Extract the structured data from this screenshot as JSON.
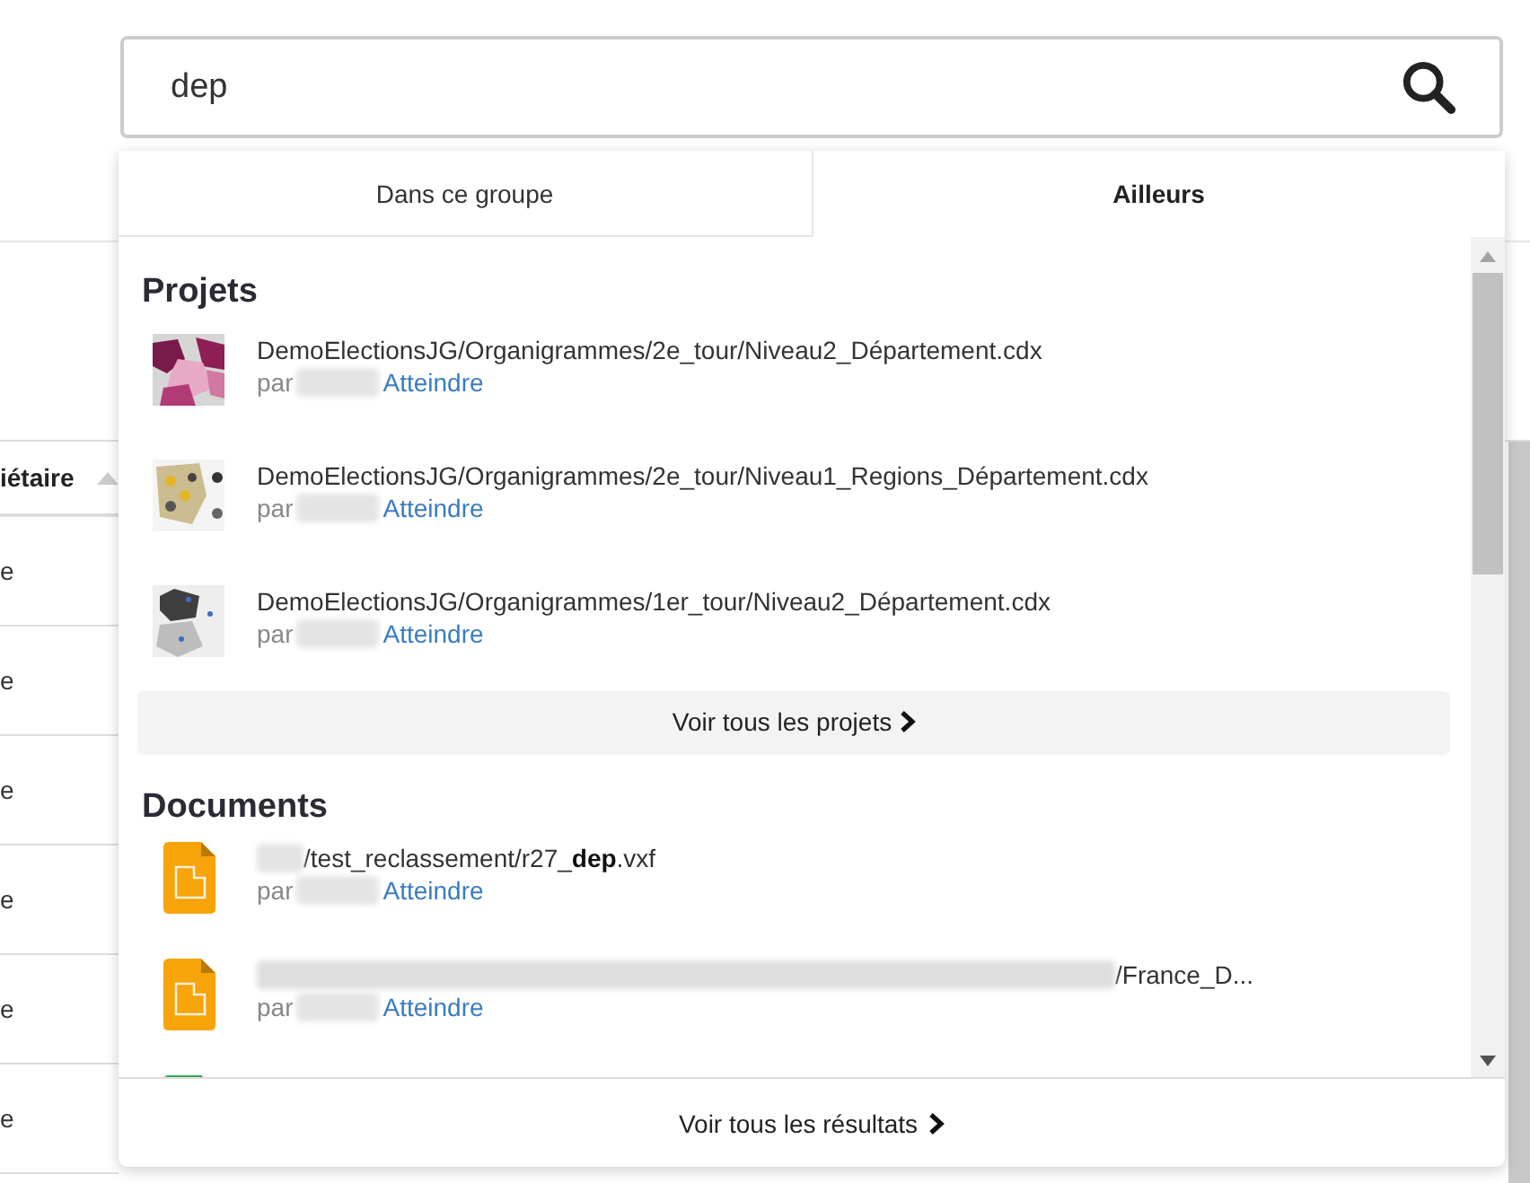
{
  "search": {
    "value": "dep"
  },
  "background_table": {
    "column_header": "iétaire",
    "cells": [
      "e",
      "e",
      "e",
      "e",
      "e",
      "e"
    ]
  },
  "dropdown": {
    "tabs": [
      {
        "label": "Dans ce groupe",
        "selected": false
      },
      {
        "label": "Ailleurs",
        "selected": true
      }
    ],
    "sections": [
      {
        "title": "Projets",
        "more": "Voir tous les projets",
        "items": [
          {
            "kind": "project",
            "path": "DemoElectionsJG/Organigrammes/2e_tour/Niveau2_Département.cdx",
            "by": "par",
            "link": "Atteindre"
          },
          {
            "kind": "project",
            "path": "DemoElectionsJG/Organigrammes/2e_tour/Niveau1_Regions_Département.cdx",
            "by": "par",
            "link": "Atteindre"
          },
          {
            "kind": "project",
            "path": "DemoElectionsJG/Organigrammes/1er_tour/Niveau2_Département.cdx",
            "by": "par",
            "link": "Atteindre"
          }
        ]
      },
      {
        "title": "Documents",
        "items": [
          {
            "kind": "document",
            "color": "#f7a30a",
            "prefix_redacted": true,
            "path": "/test_reclassement/r27_**dep**.vxf",
            "by": "par",
            "link": "Atteindre"
          },
          {
            "kind": "document",
            "color": "#f7a30a",
            "prefix_redacted": true,
            "path": "/France_D...",
            "by": "par",
            "link": "Atteindre"
          },
          {
            "kind": "document",
            "color": "#2fa84f"
          }
        ]
      }
    ],
    "footer": "Voir tous les résultats"
  }
}
